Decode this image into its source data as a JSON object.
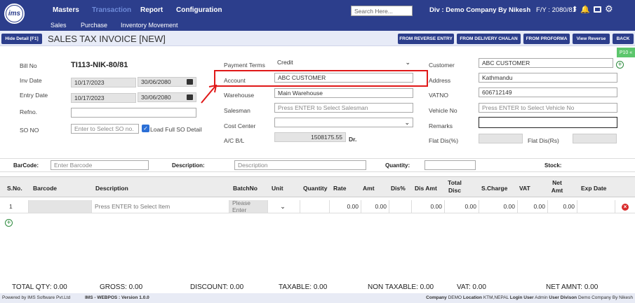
{
  "nav": {
    "logo": "ims",
    "menu": [
      "Masters",
      "Transaction",
      "Report",
      "Configuration"
    ],
    "search_placeholder": "Search Here...",
    "div_label": "Div : Demo Company By Nikesh",
    "fy_label": "F/Y : 2080/81",
    "submenu": [
      "Sales",
      "Purchase",
      "Inventory Movement"
    ]
  },
  "titlebar": {
    "hide_detail": "Hide Detail [F1]",
    "title": "SALES TAX INVOICE [NEW]",
    "buttons": [
      "FROM REVERSE ENTRY",
      "FROM DELIVERY CHALAN",
      "FROM PROFORMA",
      "View Reverse",
      "BACK"
    ]
  },
  "form": {
    "bill_no_label": "Bill No",
    "bill_no": "TI113-NIK-80/81",
    "inv_date_label": "Inv Date",
    "inv_date": "10/17/2023",
    "inv_date_bs": "30/06/2080",
    "entry_date_label": "Entry Date",
    "entry_date": "10/17/2023",
    "entry_date_bs": "30/06/2080",
    "refno_label": "Refno.",
    "refno": "",
    "so_no_label": "SO NO",
    "so_no_placeholder": "Enter to Select SO no.",
    "load_full_so": "Load Full SO Detail",
    "payment_terms_label": "Payment Terms",
    "payment_terms": "Credit",
    "account_label": "Account",
    "account": "ABC CUSTOMER",
    "warehouse_label": "Warehouse",
    "warehouse": "Main Warehouse",
    "salesman_label": "Salesman",
    "salesman_placeholder": "Press ENTER to Select Salesman",
    "cost_center_label": "Cost Center",
    "cost_center": "",
    "acbl_label": "A/C B/L",
    "acbl": "1508175.55",
    "acbl_suffix": "Dr.",
    "customer_label": "Customer",
    "customer": "ABC CUSTOMER",
    "address_label": "Address",
    "address": "Kathmandu",
    "vatno_label": "VATNO",
    "vatno": "606712149",
    "vehicle_label": "Vehicle No",
    "vehicle_placeholder": "Press ENTER to Select Vehicle No",
    "remarks_label": "Remarks",
    "remarks": "",
    "flat_dis_pct_label": "Flat Dis(%)",
    "flat_dis_rs_label": "Flat Dis(Rs)",
    "p10": "P10 «"
  },
  "barcode_row": {
    "barcode_label": "BarCode:",
    "barcode_placeholder": "Enter Barcode",
    "description_label": "Description:",
    "description_placeholder": "Description",
    "quantity_label": "Quantity:",
    "stock_label": "Stock:"
  },
  "table": {
    "headers": [
      "S.No.",
      "Barcode",
      "Description",
      "BatchNo",
      "Unit",
      "Quantity",
      "Rate",
      "Amt",
      "Dis%",
      "Dis Amt",
      "Total Disc",
      "S.Charge",
      "VAT",
      "Net Amt",
      "Exp Date"
    ],
    "row": {
      "sno": "1",
      "description_placeholder": "Press ENTER to Select Item",
      "batch_placeholder": "Please Enter",
      "rate": "0.00",
      "amt": "0.00",
      "dis_amt": "0.00",
      "total_disc": "0.00",
      "scharge": "0.00",
      "vat": "0.00",
      "net_amt": "0.00"
    }
  },
  "totals": {
    "qty": "TOTAL QTY: 0.00",
    "gross": "GROSS: 0.00",
    "discount": "DISCOUNT: 0.00",
    "taxable": "TAXABLE: 0.00",
    "non_taxable": "NON TAXABLE: 0.00",
    "vat": "VAT: 0.00",
    "net": "NET AMNT: 0.00"
  },
  "footer": {
    "left": "Powered by IMS Software Pvt.Ltd",
    "version": "IMS - WEBPOS : Version 1.0.0",
    "company_label": "Company",
    "company": "DEMO",
    "location_label": "Location",
    "location": "KTM,NEPAL",
    "login_label": "Login User",
    "login": "Admin",
    "division_label": "User Divison",
    "division": "Demo Company By Nikesh"
  }
}
